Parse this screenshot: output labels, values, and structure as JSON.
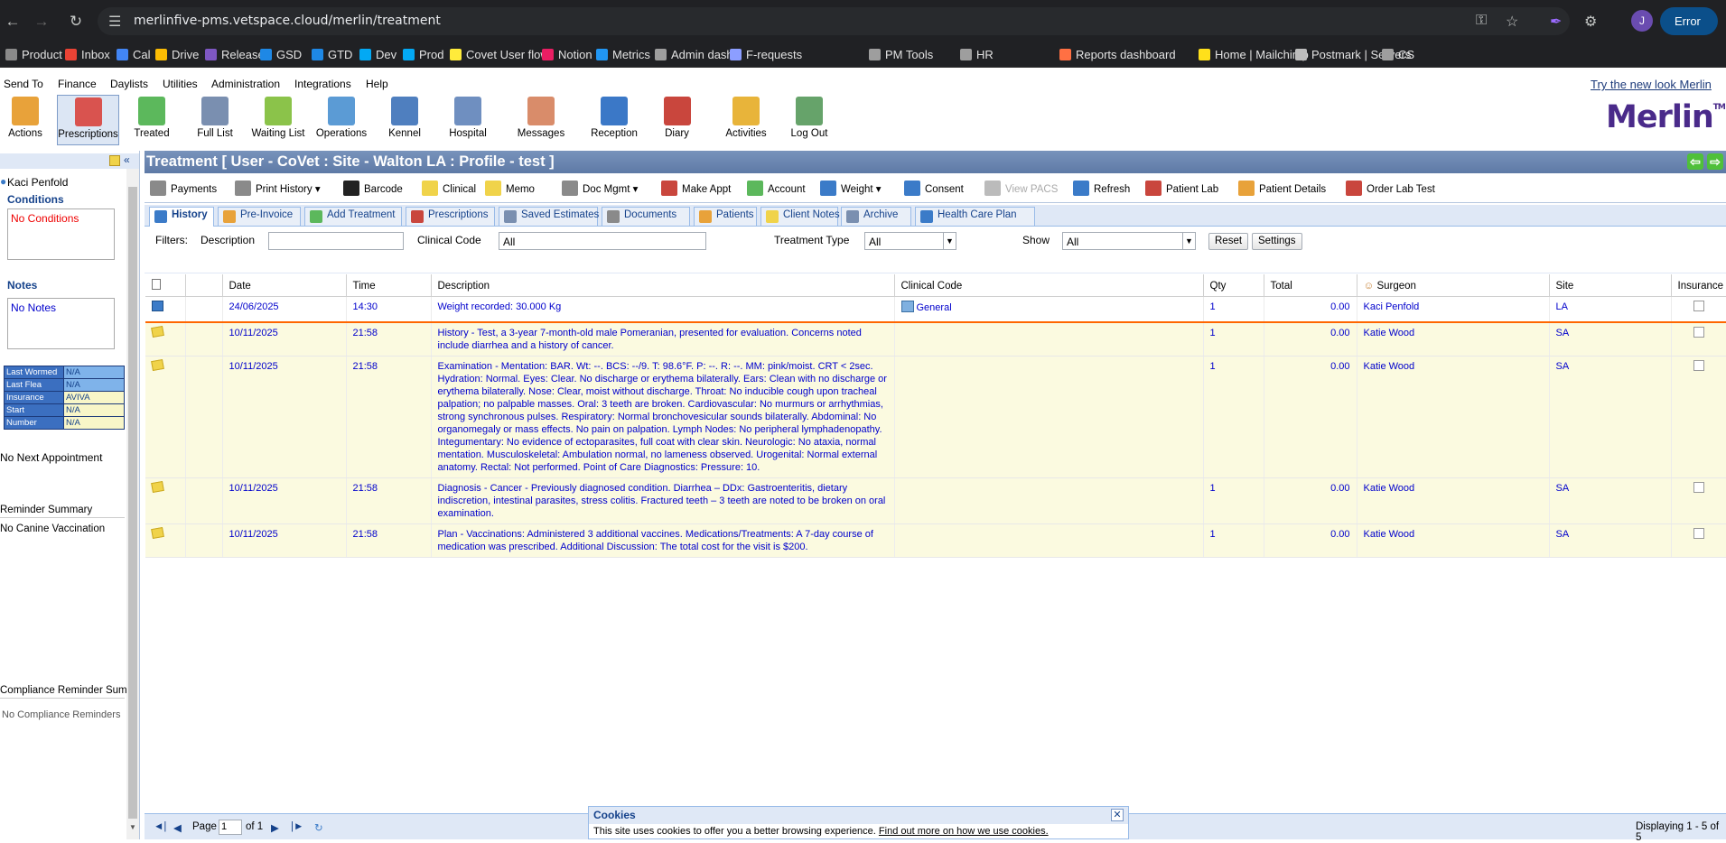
{
  "browser": {
    "url": "merlinfive-pms.vetspace.cloud/merlin/treatment",
    "profile": "J",
    "error_label": "Error"
  },
  "bookmarks": [
    {
      "label": "Product",
      "color": "#8a8a8a"
    },
    {
      "label": "Inbox",
      "color": "#ea4335"
    },
    {
      "label": "Cal",
      "color": "#4285f4"
    },
    {
      "label": "Drive",
      "color": "#fbbc04"
    },
    {
      "label": "Releases",
      "color": "#7e57c2"
    },
    {
      "label": "GSD",
      "color": "#1e88e5"
    },
    {
      "label": "GTD",
      "color": "#1e88e5"
    },
    {
      "label": "Dev",
      "color": "#03a9f4"
    },
    {
      "label": "Prod",
      "color": "#03a9f4"
    },
    {
      "label": "Covet User flow",
      "color": "#ffeb3b"
    },
    {
      "label": "Notion",
      "color": "#e91e63"
    },
    {
      "label": "Metrics",
      "color": "#2196f3"
    },
    {
      "label": "Admin dash",
      "color": "#9e9e9e"
    },
    {
      "label": "F-requests",
      "color": "#8c9eff"
    },
    {
      "label": "PM Tools",
      "color": "#9e9e9e"
    },
    {
      "label": "HR",
      "color": "#9e9e9e"
    },
    {
      "label": "Reports dashboard",
      "color": "#ff7043"
    },
    {
      "label": "Home | Mailchimp",
      "color": "#ffe01b"
    },
    {
      "label": "Postmark | Servers",
      "color": "#bdbdbd"
    },
    {
      "label": "CS",
      "color": "#9e9e9e"
    }
  ],
  "menu": [
    "Send To",
    "Finance",
    "Daylists",
    "Utilities",
    "Administration",
    "Integrations",
    "Help"
  ],
  "new_look": "Try the new look Merlin",
  "toolbar": [
    {
      "label": "Actions",
      "color": "#e8a23a"
    },
    {
      "label": "Prescriptions",
      "color": "#d9534f"
    },
    {
      "label": "Treated",
      "color": "#5cb85c"
    },
    {
      "label": "Full List",
      "color": "#7a8fb0"
    },
    {
      "label": "Waiting List",
      "color": "#8bc34a"
    },
    {
      "label": "Operations",
      "color": "#5b9bd5"
    },
    {
      "label": "Kennel",
      "color": "#4f7fbf"
    },
    {
      "label": "Hospital",
      "color": "#6f8fc0"
    },
    {
      "label": "Messages",
      "color": "#d98c6a"
    },
    {
      "label": "Reception",
      "color": "#3b78c7"
    },
    {
      "label": "Diary",
      "color": "#c9463d"
    },
    {
      "label": "Activities",
      "color": "#e8b43a"
    },
    {
      "label": "Log Out",
      "color": "#66a36a"
    }
  ],
  "logo": "Merlin",
  "left": {
    "patient": "Kaci Penfold",
    "conditions_title": "Conditions",
    "conditions_text": "No Conditions",
    "notes_title": "Notes",
    "notes_text": "No Notes",
    "tags": [
      {
        "k": "Last Wormed",
        "v": "N/A"
      },
      {
        "k": "Last Flea",
        "v": "N/A"
      },
      {
        "k": "Insurance",
        "v": "AVIVA"
      },
      {
        "k": "Start",
        "v": "N/A"
      },
      {
        "k": "Number",
        "v": "N/A"
      }
    ],
    "next_appt": "No Next Appointment",
    "reminder_title": "Reminder Summary",
    "reminder_text": "No Canine Vaccination",
    "compliance_title": "Compliance Reminder Summ",
    "compliance_text": "No Compliance Reminders"
  },
  "title": "Treatment [ User - CoVet : Site - Walton LA : Profile - test ]",
  "actions": [
    {
      "label": "Payments",
      "color": "#8a8a8a"
    },
    {
      "label": "Print History",
      "color": "#8a8a8a",
      "dd": true
    },
    {
      "label": "Barcode",
      "color": "#222"
    },
    {
      "label": "Clinical",
      "color": "#f0d34a"
    },
    {
      "label": "Memo",
      "color": "#f0d34a"
    },
    {
      "label": "Doc Mgmt",
      "color": "#8a8a8a",
      "dd": true
    },
    {
      "label": "Make Appt",
      "color": "#c9463d"
    },
    {
      "label": "Account",
      "color": "#5cb85c"
    },
    {
      "label": "Weight",
      "color": "#3b7bc8",
      "dd": true
    },
    {
      "label": "Consent",
      "color": "#3b7bc8"
    },
    {
      "label": "View PACS",
      "color": "#bbb",
      "disabled": true
    },
    {
      "label": "Refresh",
      "color": "#3b7bc8"
    },
    {
      "label": "Patient Lab",
      "color": "#c9463d"
    },
    {
      "label": "Patient Details",
      "color": "#e8a23a"
    },
    {
      "label": "Order Lab Test",
      "color": "#c9463d"
    }
  ],
  "tabs": [
    "History",
    "Pre-Invoice",
    "Add Treatment",
    "Prescriptions",
    "Saved Estimates",
    "Documents",
    "Patients",
    "Client Notes",
    "Archive",
    "Health Care Plan"
  ],
  "filters": {
    "label": "Filters:",
    "desc_label": "Description",
    "desc_value": "",
    "code_label": "Clinical Code",
    "code_value": "All",
    "type_label": "Treatment Type",
    "type_value": "All",
    "show_label": "Show",
    "show_value": "All",
    "reset": "Reset",
    "settings": "Settings"
  },
  "columns": [
    "Date",
    "Time",
    "Description",
    "Clinical Code",
    "Qty",
    "Total",
    "Surgeon",
    "Site",
    "Insurance"
  ],
  "rows": [
    {
      "date": "24/06/2025",
      "time": "14:30",
      "desc": "Weight recorded: 30.000 Kg",
      "code": "General",
      "qty": "1",
      "total": "0.00",
      "surgeon": "Kaci Penfold",
      "site": "LA"
    },
    {
      "date": "10/11/2025",
      "time": "21:58",
      "desc": "History - Test, a 3-year 7-month-old male Pomeranian, presented for evaluation. Concerns noted include diarrhea and a history of cancer.",
      "code": "",
      "qty": "1",
      "total": "0.00",
      "surgeon": "Katie Wood",
      "site": "SA"
    },
    {
      "date": "10/11/2025",
      "time": "21:58",
      "desc": "Examination - Mentation: BAR. Wt: --. BCS: --/9. T: 98.6°F. P: --. R: --. MM: pink/moist. CRT < 2sec. Hydration: Normal. Eyes: Clear. No discharge or erythema bilaterally. Ears: Clean with no discharge or erythema bilaterally. Nose: Clear, moist without discharge. Throat: No inducible cough upon tracheal palpation; no palpable masses. Oral: 3 teeth are broken. Cardiovascular: No murmurs or arrhythmias, strong synchronous pulses. Respiratory: Normal bronchovesicular sounds bilaterally. Abdominal: No organomegaly or mass effects. No pain on palpation. Lymph Nodes: No peripheral lymphadenopathy. Integumentary: No evidence of ectoparasites, full coat with clear skin. Neurologic: No ataxia, normal mentation. Musculoskeletal: Ambulation normal, no lameness observed. Urogenital: Normal external anatomy. Rectal: Not performed. Point of Care Diagnostics: Pressure: 10.",
      "code": "",
      "qty": "1",
      "total": "0.00",
      "surgeon": "Katie Wood",
      "site": "SA"
    },
    {
      "date": "10/11/2025",
      "time": "21:58",
      "desc": "Diagnosis - Cancer - Previously diagnosed condition. Diarrhea – DDx: Gastroenteritis, dietary indiscretion, intestinal parasites, stress colitis. Fractured teeth – 3 teeth are noted to be broken on oral examination.",
      "code": "",
      "qty": "1",
      "total": "0.00",
      "surgeon": "Katie Wood",
      "site": "SA"
    },
    {
      "date": "10/11/2025",
      "time": "21:58",
      "desc": "Plan - Vaccinations: Administered 3 additional vaccines. Medications/Treatments: A 7-day course of medication was prescribed. Additional Discussion: The total cost for the visit is $200.",
      "code": "",
      "qty": "1",
      "total": "0.00",
      "surgeon": "Katie Wood",
      "site": "SA"
    }
  ],
  "pager": {
    "page_label": "Page",
    "page_value": "1",
    "of_label": "of 1",
    "displaying": "Displaying 1 - 5 of 5"
  },
  "cookie": {
    "title": "Cookies",
    "text": "This site uses cookies to offer you a better browsing experience.",
    "link": "Find out more on how we use cookies."
  }
}
